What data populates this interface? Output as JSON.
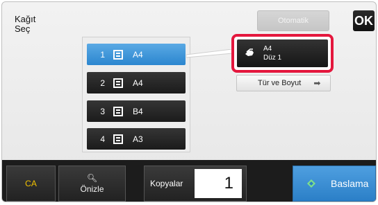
{
  "header": {
    "title_line1": "Kağıt",
    "title_line2": "Seç",
    "auto_label": "Otomatik",
    "ok_label": "OK"
  },
  "trays": [
    {
      "number": "1",
      "size": "A4",
      "selected": true
    },
    {
      "number": "2",
      "size": "A4",
      "selected": false
    },
    {
      "number": "3",
      "size": "B4",
      "selected": false
    },
    {
      "number": "4",
      "size": "A3",
      "selected": false
    }
  ],
  "paper_info": {
    "size": "A4",
    "type": "Düz 1"
  },
  "type_size_button": "Tür ve Boyut",
  "bottom_bar": {
    "ca_label": "CA",
    "preview_label": "Önizle",
    "copies_label": "Kopyalar",
    "copies_value": "1",
    "start_label": "Baslama"
  },
  "colors": {
    "accent": "#2b86cf",
    "highlight": "#e4173d",
    "ca": "#f2c200"
  }
}
